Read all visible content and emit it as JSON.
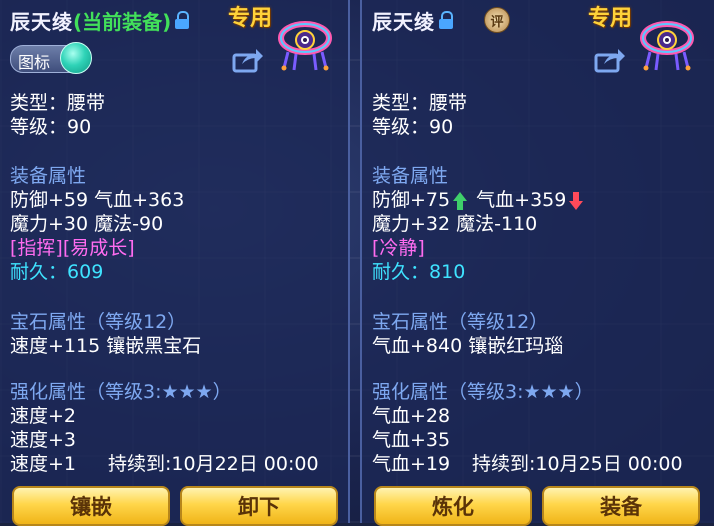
{
  "left": {
    "name": "辰天绫",
    "equipped_tag": "(当前装备)",
    "exclusive": "专用",
    "icon_toggle_label": "图标",
    "type_line": "类型：腰带",
    "level_line": "等级：90",
    "attr_head": "装备属性",
    "attr_line1": "防御+59 气血+363",
    "attr_line2": "魔力+30 魔法-90",
    "special": "[指挥][易成长]",
    "durability_label": "耐久：",
    "durability_value": "609",
    "gem_head": "宝石属性（等级12）",
    "gem_line": "速度+115 镶嵌黑宝石",
    "enhance_head": "强化属性（等级3:★★★）",
    "enhance_lines": [
      "速度+2",
      "速度+3",
      "速度+1"
    ],
    "duration": "持续到:10月22日 00:00",
    "buttons": [
      "镶嵌",
      "卸下"
    ]
  },
  "right": {
    "name": "辰天绫",
    "rate_badge": "评",
    "exclusive": "专用",
    "type_line": "类型：腰带",
    "level_line": "等级：90",
    "attr_head": "装备属性",
    "defense": "防御+75",
    "hp": "气血+359",
    "attr_line2": "魔力+32 魔法-110",
    "special": "[冷静]",
    "durability_label": "耐久：",
    "durability_value": "810",
    "gem_head": "宝石属性（等级12）",
    "gem_line": "气血+840 镶嵌红玛瑙",
    "enhance_head": "强化属性（等级3:★★★）",
    "enhance_lines": [
      "气血+28",
      "气血+35",
      "气血+19"
    ],
    "duration": "持续到:10月25日 00:00",
    "buttons": [
      "炼化",
      "装备"
    ]
  },
  "colors": {
    "equipped": "#42e05a",
    "heading": "#7ea8f0",
    "special": "#ff6cf0",
    "durability": "#3fe3ff",
    "exclusive": "#ffd23a",
    "up_arrow": "#3fcf6a",
    "down_arrow": "#ff4a5a"
  }
}
